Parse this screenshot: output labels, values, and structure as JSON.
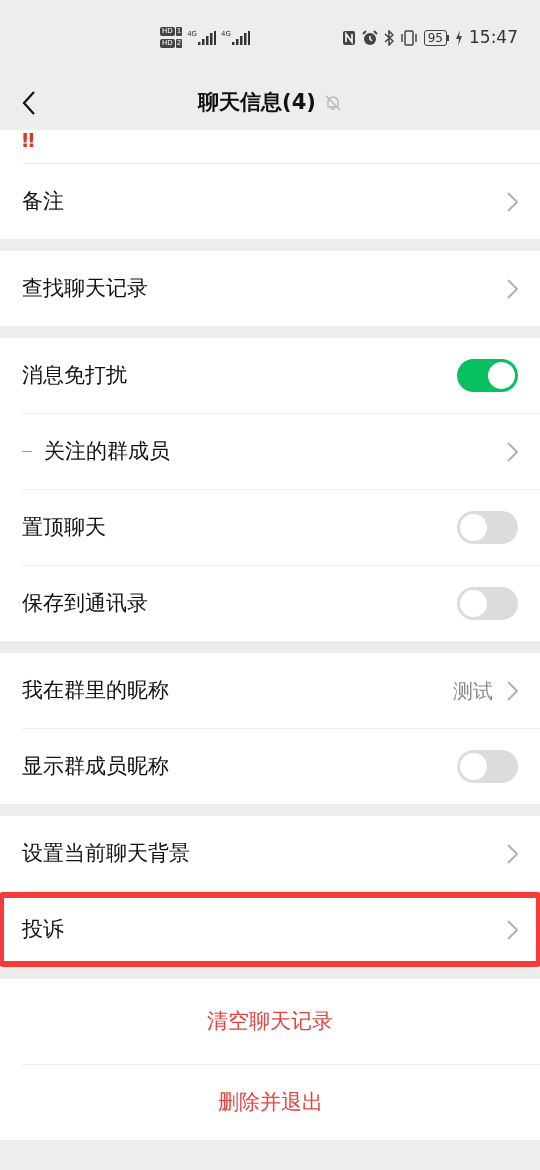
{
  "status_bar": {
    "sim_1": {
      "badge": "HD",
      "slot": "1",
      "network": "4G"
    },
    "sim_2": {
      "badge": "HD",
      "slot": "2",
      "network": "4G"
    },
    "battery": "95",
    "time": "15:47"
  },
  "nav_bar": {
    "title": "聊天信息(4)",
    "muted": true
  },
  "groups": [
    {
      "rows": [
        {
          "kind": "emoji",
          "label": "‼"
        },
        {
          "kind": "link",
          "label": "备注",
          "highlighted": false
        }
      ]
    },
    {
      "rows": [
        {
          "kind": "link",
          "label": "查找聊天记录",
          "highlighted": false
        }
      ]
    },
    {
      "rows": [
        {
          "kind": "toggle",
          "label": "消息免打扰",
          "on": true,
          "highlighted": false
        },
        {
          "kind": "sub_link",
          "label": "关注的群成员",
          "highlighted": false
        },
        {
          "kind": "toggle",
          "label": "置顶聊天",
          "on": false,
          "highlighted": false
        },
        {
          "kind": "toggle",
          "label": "保存到通讯录",
          "on": false,
          "highlighted": false
        }
      ]
    },
    {
      "rows": [
        {
          "kind": "link",
          "label": "我在群里的昵称",
          "value": "测试",
          "highlighted": false
        },
        {
          "kind": "toggle",
          "label": "显示群成员昵称",
          "on": false,
          "highlighted": false
        }
      ]
    },
    {
      "rows": [
        {
          "kind": "link",
          "label": "设置当前聊天背景",
          "highlighted": false
        },
        {
          "kind": "link",
          "label": "投诉",
          "highlighted": true
        }
      ]
    },
    {
      "rows": [
        {
          "kind": "danger",
          "label": "清空聊天记录",
          "highlighted": false
        },
        {
          "kind": "danger",
          "label": "删除并退出",
          "highlighted": false
        }
      ]
    }
  ]
}
